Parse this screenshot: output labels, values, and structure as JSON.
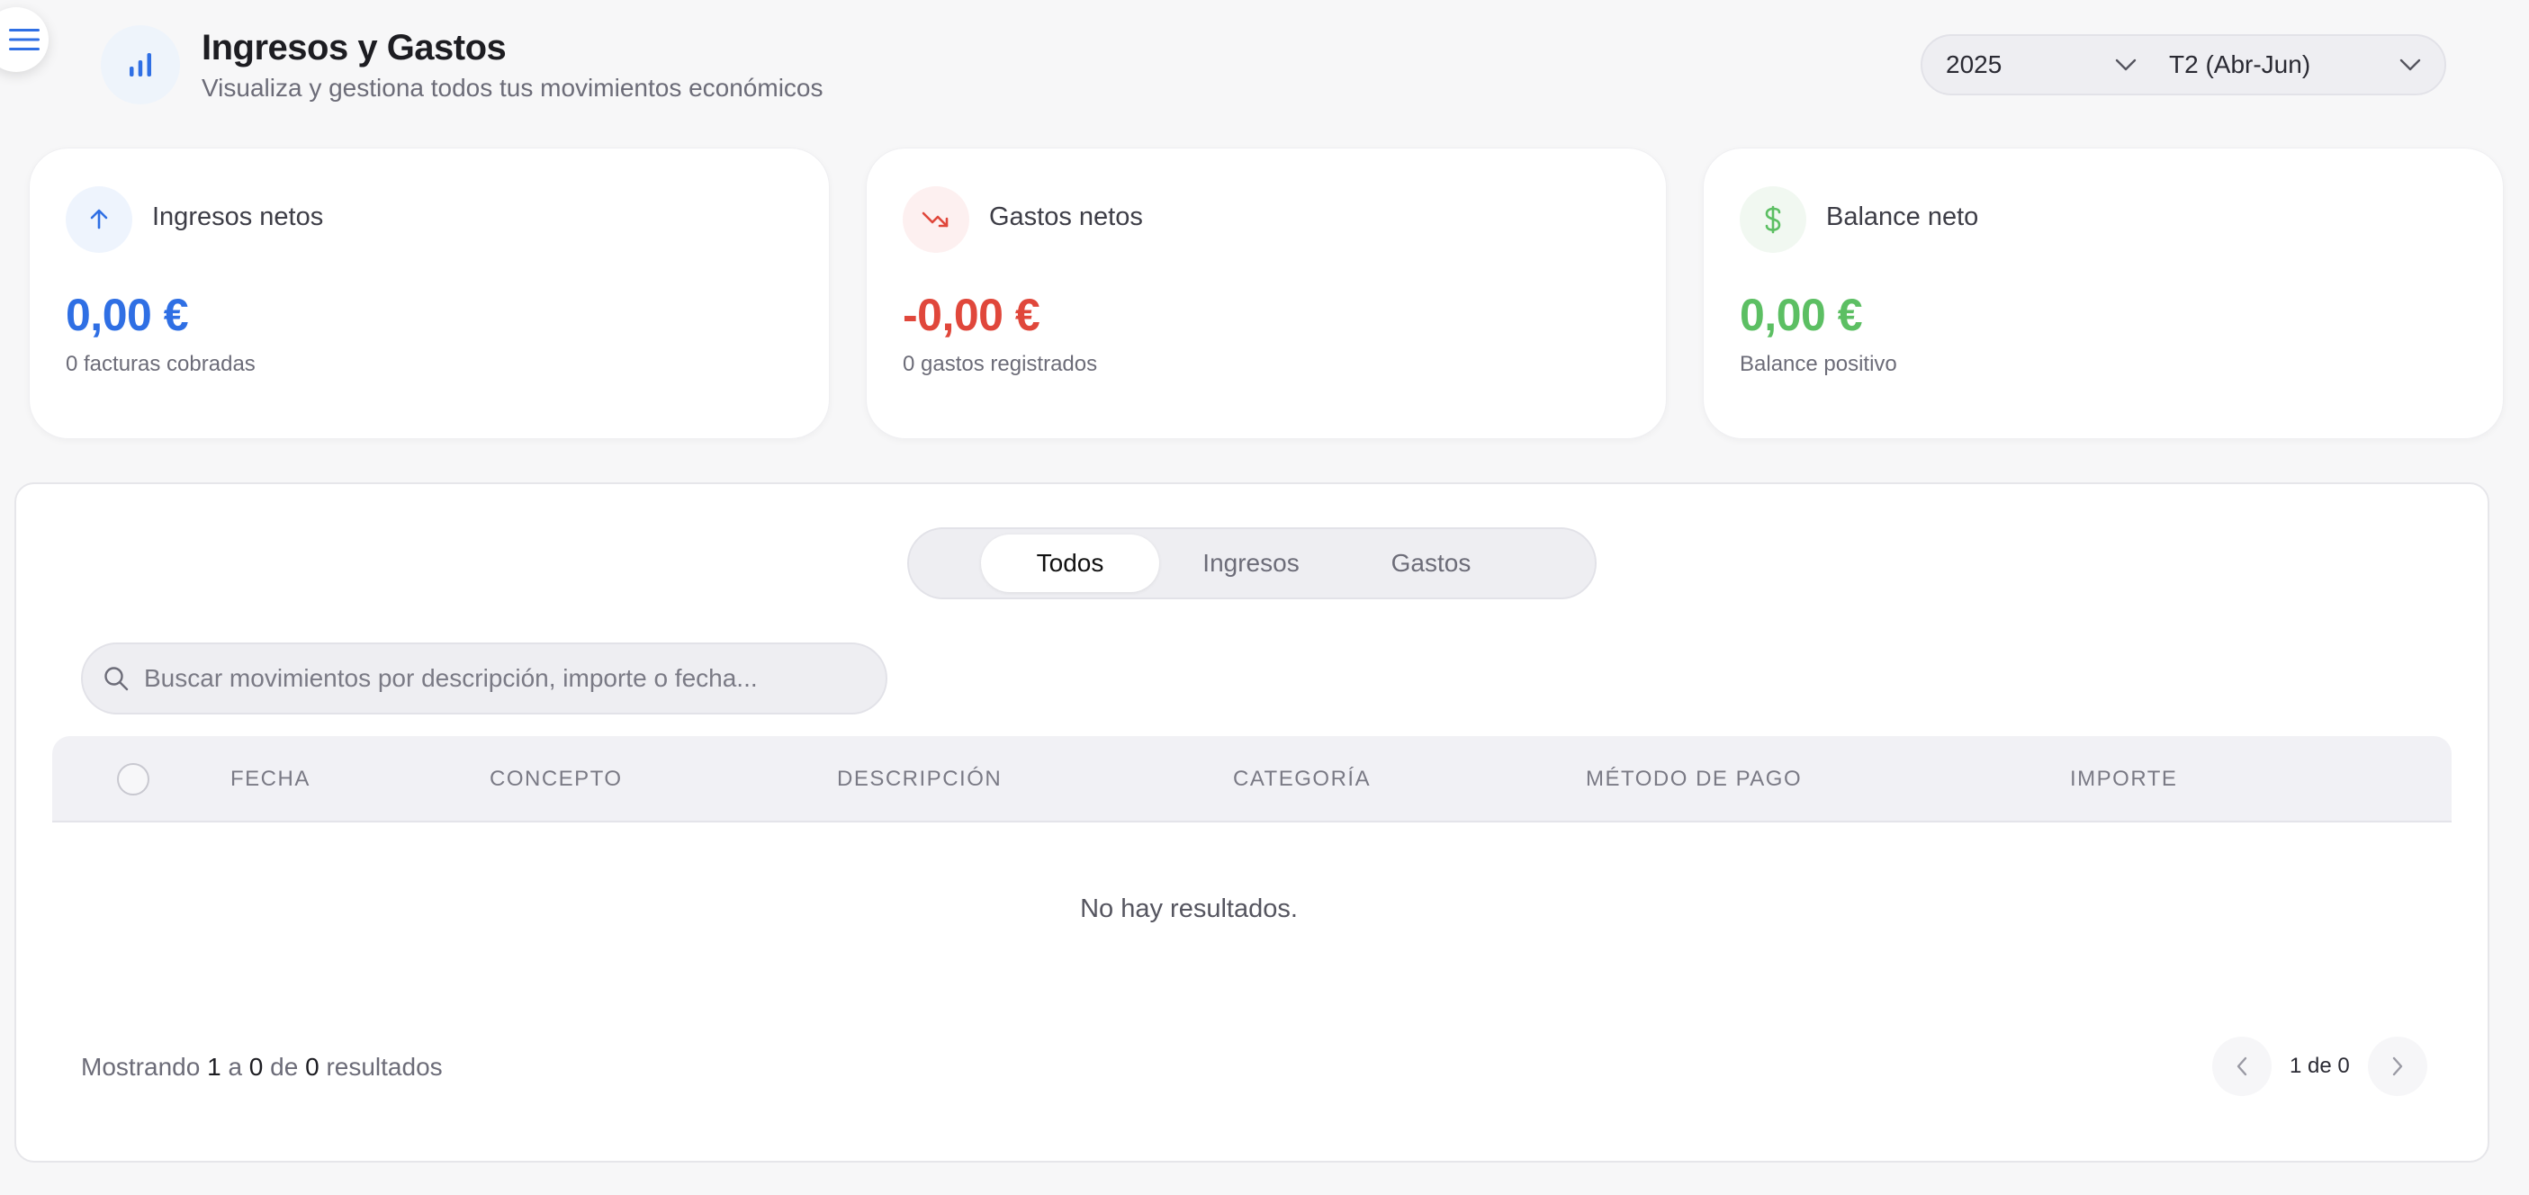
{
  "header": {
    "title": "Ingresos y Gastos",
    "subtitle": "Visualiza y gestiona todos tus movimientos económicos",
    "icon": "bar-chart-icon"
  },
  "filters": {
    "year": "2025",
    "quarter": "T2 (Abr-Jun)"
  },
  "cards": [
    {
      "label": "Ingresos netos",
      "value": "0,00 €",
      "sub": "0 facturas cobradas",
      "icon": "arrow-up-icon",
      "color": "#2f6fe4"
    },
    {
      "label": "Gastos netos",
      "value": "-0,00 €",
      "sub": "0 gastos registrados",
      "icon": "trending-down-icon",
      "color": "#e0473b"
    },
    {
      "label": "Balance neto",
      "value": "0,00 €",
      "sub": "Balance positivo",
      "icon": "dollar-icon",
      "color": "#5cbf63"
    }
  ],
  "tabs": [
    "Todos",
    "Ingresos",
    "Gastos"
  ],
  "active_tab": "Todos",
  "search": {
    "placeholder": "Buscar movimientos por descripción, importe o fecha..."
  },
  "table": {
    "columns": [
      "FECHA",
      "CONCEPTO",
      "DESCRIPCIÓN",
      "CATEGORÍA",
      "MÉTODO DE PAGO",
      "IMPORTE"
    ],
    "rows": [],
    "empty_text": "No hay resultados."
  },
  "footer": {
    "showing_prefix": "Mostrando",
    "from": "1",
    "a": "a",
    "to": "0",
    "de": "de",
    "total": "0",
    "suffix": "resultados",
    "page_label": "1 de 0"
  }
}
